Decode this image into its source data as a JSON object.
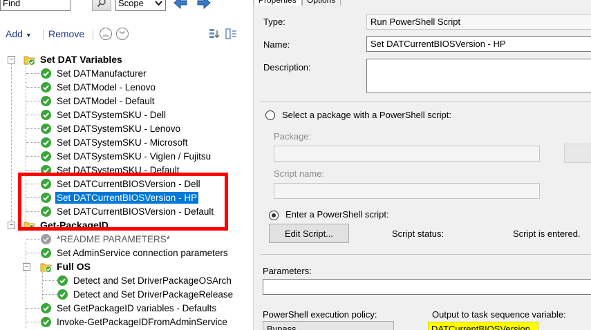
{
  "find": {
    "value": "Find",
    "scope": "Scope"
  },
  "toolbar": {
    "add": "Add",
    "remove": "Remove"
  },
  "tree": {
    "group1": "Set DAT Variables",
    "items1": [
      "Set DATManufacturer",
      "Set DATModel - Lenovo",
      "Set DATModel - Default",
      "Set DATSystemSKU - Dell",
      "Set DATSystemSKU - Lenovo",
      "Set DATSystemSKU - Microsoft",
      "Set DATSystemSKU - Viglen / Fujitsu",
      "Set DATSystemSKU - Default",
      "Set DATCurrentBIOSVersion - Dell",
      "Set DATCurrentBIOSVersion - HP",
      "Set DATCurrentBIOSVersion - Default"
    ],
    "group2": "Get-PackageID",
    "items2": [
      "*README PARAMETERS*",
      "Set AdminService connection parameters"
    ],
    "group3": "Full OS",
    "items3": [
      "Detect and Set DriverPackageOSArch",
      "Detect and Set DriverPackageRelease"
    ],
    "items4": [
      "Set GetPackageID variables - Defaults",
      "Invoke-GetPackageIDFromAdminService"
    ]
  },
  "tabs": {
    "properties": "Properties",
    "options": "Options"
  },
  "props": {
    "type_label": "Type:",
    "type_value": "Run PowerShell Script",
    "name_label": "Name:",
    "name_value": "Set DATCurrentBIOSVersion - HP",
    "description_label": "Description:",
    "description_value": "",
    "radio_package": "Select a package with a PowerShell script:",
    "package_label": "Package:",
    "script_name_label": "Script name:",
    "radio_enter": "Enter a PowerShell script:",
    "edit_script": "Edit Script...",
    "script_status_label": "Script status:",
    "script_status_value": "Script is entered.",
    "parameters_label": "Parameters:",
    "execution_policy_label": "PowerShell execution policy:",
    "execution_policy_value": "Bypass",
    "output_label": "Output to task sequence variable:",
    "output_value": "DATCurrentBIOSVersion"
  },
  "colors": {
    "selection": "#0078d7",
    "highlight_box": "#ff0000",
    "output_highlight": "#ffff00",
    "check_green": "#3aa63a"
  }
}
